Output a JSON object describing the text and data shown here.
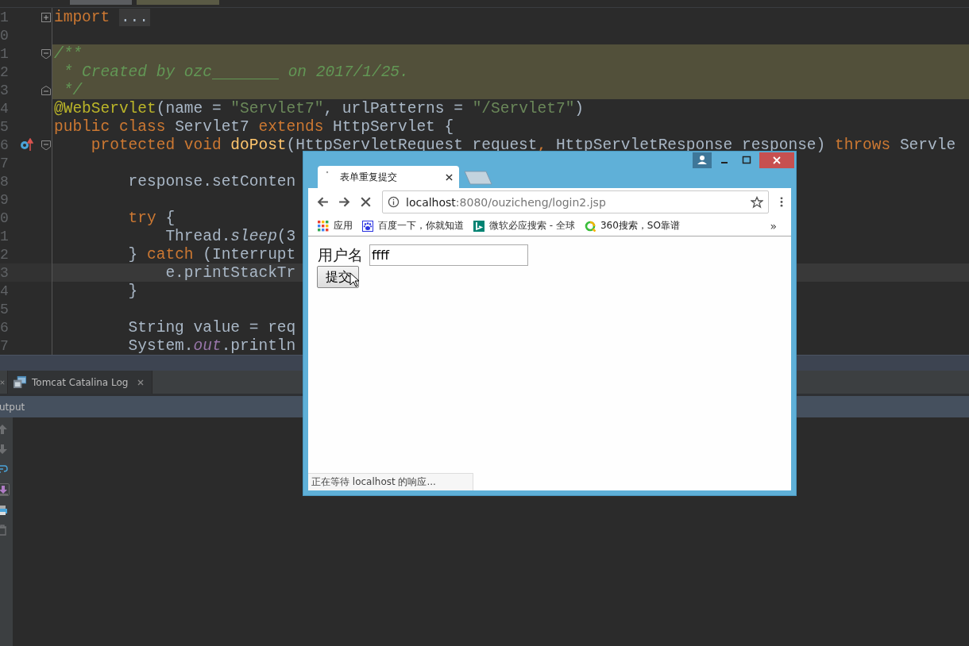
{
  "editor": {
    "lines": [
      {
        "number": "1",
        "fold": {
          "kind": "plus"
        },
        "highlighted": false,
        "current": false,
        "tokens": [
          {
            "kind": "k",
            "text": "import "
          },
          {
            "kind": "folded",
            "text": "..."
          }
        ]
      },
      {
        "number": "0",
        "highlighted": false,
        "current": false
      },
      {
        "number": "1",
        "fold": {
          "kind": "start"
        },
        "highlighted": true,
        "current": false,
        "tokens": [
          {
            "kind": "c",
            "text": "/**"
          }
        ]
      },
      {
        "number": "2",
        "highlighted": true,
        "current": false,
        "tokens": [
          {
            "kind": "c",
            "text": " * Created by ozc"
          },
          {
            "kind": "gap"
          },
          {
            "kind": "c",
            "text": " on 2017/1/25."
          }
        ]
      },
      {
        "number": "3",
        "fold": {
          "kind": "end"
        },
        "highlighted": true,
        "current": false,
        "tokens": [
          {
            "kind": "c",
            "text": " */"
          }
        ]
      },
      {
        "number": "4",
        "highlighted": false,
        "current": false,
        "tokens": [
          {
            "kind": "a",
            "text": "@WebServlet"
          },
          {
            "kind": "p",
            "text": "(name = "
          },
          {
            "kind": "s",
            "text": "\"Servlet7\""
          },
          {
            "kind": "p",
            "text": ", urlPatterns = "
          },
          {
            "kind": "s",
            "text": "\"/Servlet7\""
          },
          {
            "kind": "p",
            "text": ")"
          }
        ]
      },
      {
        "number": "5",
        "highlighted": false,
        "current": false,
        "tokens": [
          {
            "kind": "k",
            "text": "public class "
          },
          {
            "kind": "p",
            "text": "Servlet7 "
          },
          {
            "kind": "k",
            "text": "extends "
          },
          {
            "kind": "p",
            "text": "HttpServlet {"
          }
        ]
      },
      {
        "number": "6",
        "gutter_icon": {
          "kind": "override"
        },
        "fold": {
          "kind": "start"
        },
        "highlighted": false,
        "current": false,
        "tokens": [
          {
            "kind": "k",
            "text": "    protected void "
          },
          {
            "kind": "m",
            "text": "doPost"
          },
          {
            "kind": "p",
            "text": "(HttpServletRequest request"
          },
          {
            "kind": "k",
            "text": ","
          },
          {
            "kind": "p",
            "text": " HttpServletResponse response) "
          },
          {
            "kind": "k",
            "text": "throws "
          },
          {
            "kind": "p",
            "text": "Servle"
          }
        ]
      },
      {
        "number": "7",
        "highlighted": false,
        "current": false
      },
      {
        "number": "8",
        "highlighted": false,
        "current": false,
        "tokens": [
          {
            "kind": "p",
            "text": "        response.setConten"
          }
        ]
      },
      {
        "number": "9",
        "highlighted": false,
        "current": false
      },
      {
        "number": "0",
        "highlighted": false,
        "current": false,
        "tokens": [
          {
            "kind": "k",
            "text": "        try "
          },
          {
            "kind": "p",
            "text": "{"
          }
        ]
      },
      {
        "number": "1",
        "highlighted": false,
        "current": false,
        "tokens": [
          {
            "kind": "p",
            "text": "            Thread."
          },
          {
            "kind": "i",
            "text": "sleep"
          },
          {
            "kind": "p",
            "text": "(3"
          }
        ]
      },
      {
        "number": "2",
        "highlighted": false,
        "current": false,
        "tokens": [
          {
            "kind": "p",
            "text": "        } "
          },
          {
            "kind": "k",
            "text": "catch "
          },
          {
            "kind": "p",
            "text": "(Interrupt"
          }
        ]
      },
      {
        "number": "3",
        "highlighted": false,
        "current": true,
        "tokens": [
          {
            "kind": "p",
            "text": "            e.printStackTr"
          }
        ]
      },
      {
        "number": "4",
        "highlighted": false,
        "current": false,
        "tokens": [
          {
            "kind": "p",
            "text": "        }"
          }
        ]
      },
      {
        "number": "5",
        "highlighted": false,
        "current": false
      },
      {
        "number": "6",
        "highlighted": false,
        "current": false,
        "tokens": [
          {
            "kind": "p",
            "text": "        String value = req"
          }
        ]
      },
      {
        "number": "7",
        "highlighted": false,
        "current": false,
        "tokens": [
          {
            "kind": "p",
            "text": "        System."
          },
          {
            "kind": "f",
            "text": "out"
          },
          {
            "kind": "p",
            "text": ".println"
          }
        ]
      }
    ]
  },
  "bottom_panel": {
    "tabs": [
      {
        "label": "Tomcat Catalina Log"
      }
    ],
    "output_title": "utput"
  },
  "browser": {
    "tab": {
      "title": "表单重复提交"
    },
    "address": {
      "host": "localhost",
      "path": ":8080/ouzicheng/login2.jsp"
    },
    "bookmarks": [
      {
        "kind": "apps",
        "label": "应用"
      },
      {
        "kind": "paw",
        "label": "百度一下，你就知道"
      },
      {
        "kind": "bing",
        "label": "微软必应搜索 - 全球"
      },
      {
        "kind": "ring",
        "label": "360搜索，SO靠谱"
      }
    ],
    "overflow": "»",
    "page": {
      "label": "用户名",
      "input_value": "ffff",
      "button": "提交"
    },
    "status": "正在等待 localhost 的响应..."
  }
}
